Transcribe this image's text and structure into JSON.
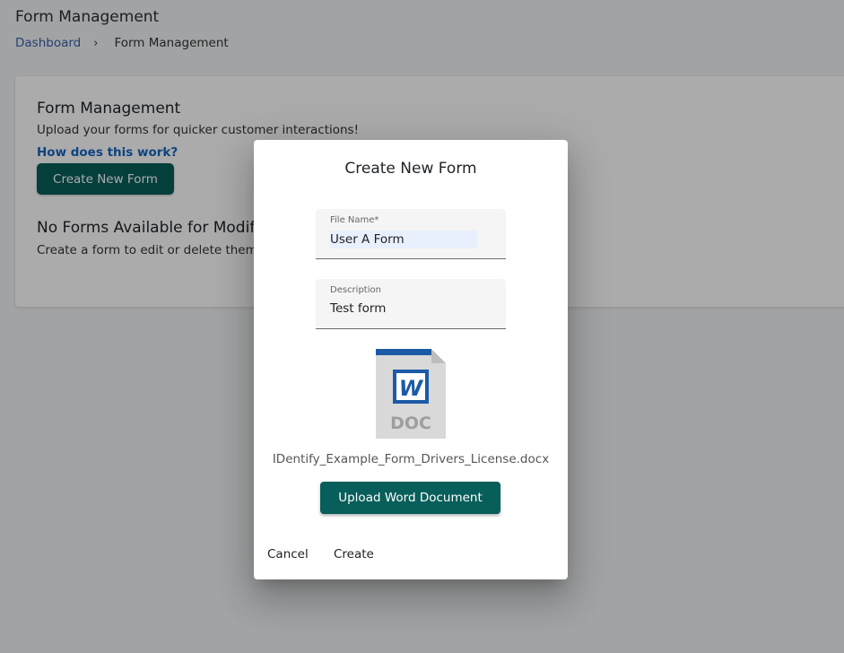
{
  "page": {
    "title": "Form Management",
    "breadcrumb": {
      "items": [
        "Dashboard",
        "Form Management"
      ],
      "separator": "›"
    }
  },
  "card": {
    "title": "Form Management",
    "subtitle": "Upload your forms for quicker customer interactions!",
    "help_link": "How does this work?",
    "create_button": "Create New Form",
    "empty_title": "No Forms Available for Modification",
    "empty_subtitle": "Create a form to edit or delete them."
  },
  "dialog": {
    "title": "Create New Form",
    "file_name_field": {
      "label": "File Name*",
      "value": "User A Form"
    },
    "description_field": {
      "label": "Description",
      "value": "Test form"
    },
    "document": {
      "icon": "word-doc-icon",
      "icon_text": "DOC",
      "icon_letter": "W",
      "file_name": "IDentify_Example_Form_Drivers_License.docx"
    },
    "upload_button": "Upload Word Document",
    "cancel_button": "Cancel",
    "create_button": "Create"
  },
  "colors": {
    "primary": "#075e5a",
    "link": "#3b5fa8",
    "help_link": "#1565c0",
    "word_blue": "#1c5aa6"
  }
}
